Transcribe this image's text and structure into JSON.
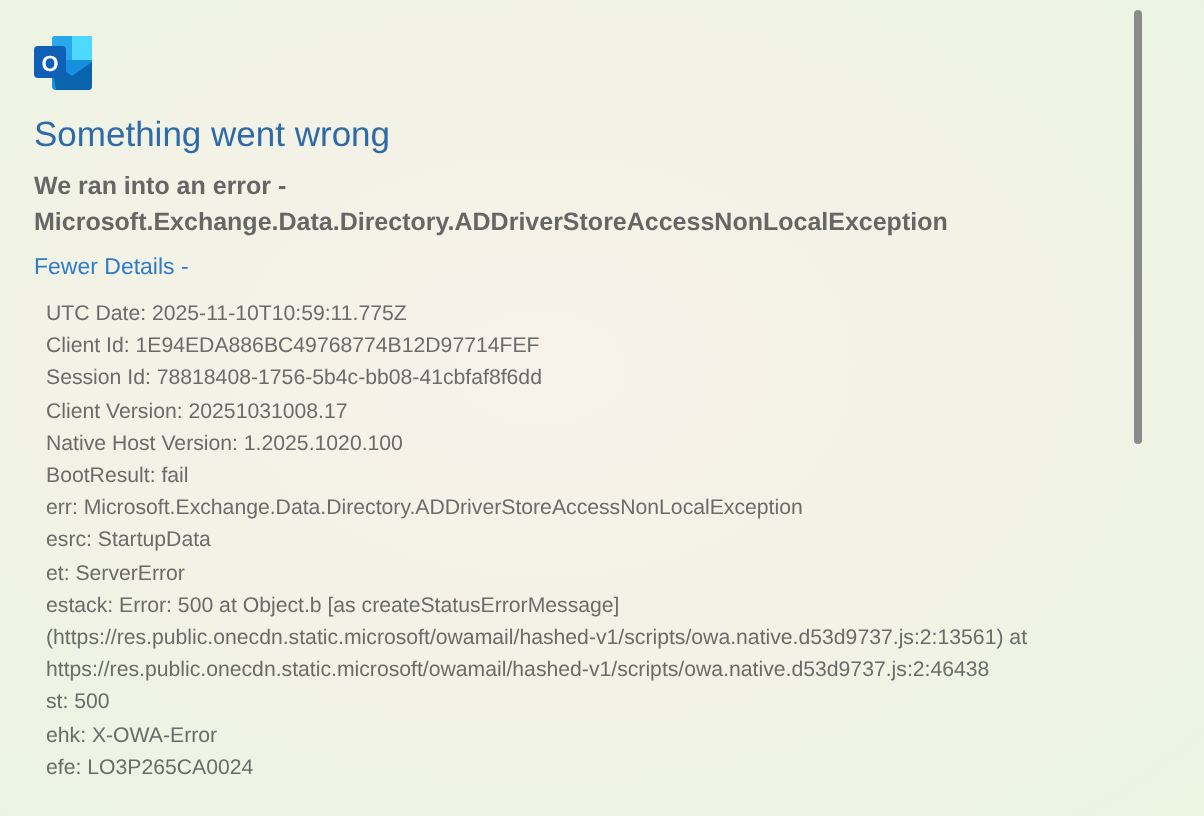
{
  "app_icon": {
    "letter": "O"
  },
  "title": "Something went wrong",
  "message": [
    "We ran into an error -",
    "Microsoft.Exchange.Data.Directory.ADDriverStoreAccessNonLocalException"
  ],
  "details_toggle": {
    "label": "Fewer Details -"
  },
  "details": [
    "UTC Date: 2025-11-10T10:59:11.775Z",
    "Client Id: 1E94EDA886BC49768774B12D97714FEF",
    "Session Id: 78818408-1756-5b4c-bb08-41cbfaf8f6dd",
    "Client Version: 20251031008.17",
    "Native Host Version: 1.2025.1020.100",
    "BootResult: fail",
    "err: Microsoft.Exchange.Data.Directory.ADDriverStoreAccessNonLocalException",
    "esrc: StartupData",
    "et: ServerError",
    "estack: Error: 500 at Object.b [as createStatusErrorMessage]",
    "(https://res.public.onecdn.static.microsoft/owamail/hashed-v1/scripts/owa.native.d53d9737.js:2:13561) at",
    "https://res.public.onecdn.static.microsoft/owamail/hashed-v1/scripts/owa.native.d53d9737.js:2:46438",
    "st: 500",
    "ehk: X-OWA-Error",
    "efe: LO3P265CA0024"
  ]
}
